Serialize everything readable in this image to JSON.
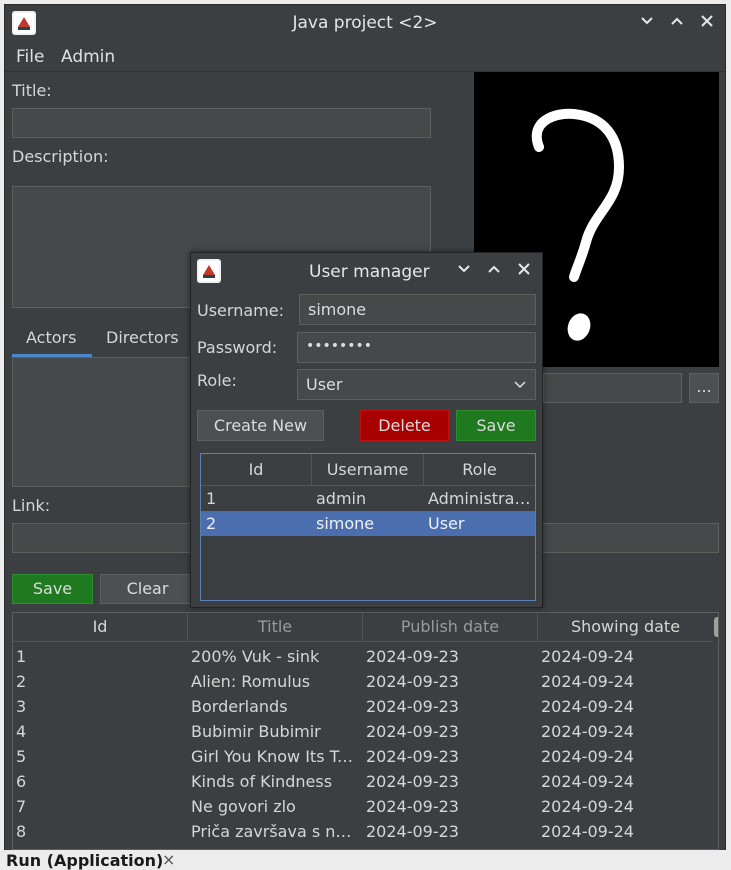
{
  "window": {
    "title": "Java project <2>"
  },
  "menu": {
    "file": "File",
    "admin": "Admin"
  },
  "form": {
    "title_label": "Title:",
    "title_value": "",
    "description_label": "Description:",
    "tabs": [
      "Actors",
      "Directors"
    ],
    "link_label": "Link:",
    "save_label": "Save",
    "clear_label": "Clear",
    "browse_label": "..."
  },
  "movies": {
    "columns": [
      "Id",
      "Title",
      "Publish date",
      "Showing date"
    ],
    "rows": [
      [
        "1",
        "200% Vuk - sink",
        "2024-09-23",
        "2024-09-24"
      ],
      [
        "2",
        "Alien: Romulus",
        "2024-09-23",
        "2024-09-24"
      ],
      [
        "3",
        "Borderlands",
        "2024-09-23",
        "2024-09-24"
      ],
      [
        "4",
        "Bubimir Bubimir",
        "2024-09-23",
        "2024-09-24"
      ],
      [
        "5",
        "Girl You Know Its Tr...",
        "2024-09-23",
        "2024-09-24"
      ],
      [
        "6",
        "Kinds of Kindness",
        "2024-09-23",
        "2024-09-24"
      ],
      [
        "7",
        "Ne govori zlo",
        "2024-09-23",
        "2024-09-24"
      ],
      [
        "8",
        "Priča završava s na...",
        "2024-09-23",
        "2024-09-24"
      ]
    ]
  },
  "dialog": {
    "title": "User manager",
    "username_label": "Username:",
    "username_value": "simone",
    "password_label": "Password:",
    "password_value": "••••••••",
    "role_label": "Role:",
    "role_value": "User",
    "create_label": "Create New",
    "delete_label": "Delete",
    "save_label": "Save",
    "columns": [
      "Id",
      "Username",
      "Role"
    ],
    "rows": [
      [
        "1",
        "admin",
        "Administrat..."
      ],
      [
        "2",
        "simone",
        "User"
      ]
    ]
  },
  "bottom": {
    "run_tab": "Run (Application)",
    "close": "×"
  },
  "colors": {
    "delete": "#a80000",
    "save": "#1f7a1f",
    "selection": "#4b6eaf",
    "tab_underline": "#4a88c7"
  },
  "icons": [
    "app-icon",
    "minimize-icon",
    "maximize-icon",
    "close-icon",
    "chevron-down-icon",
    "question-mark-icon"
  ]
}
